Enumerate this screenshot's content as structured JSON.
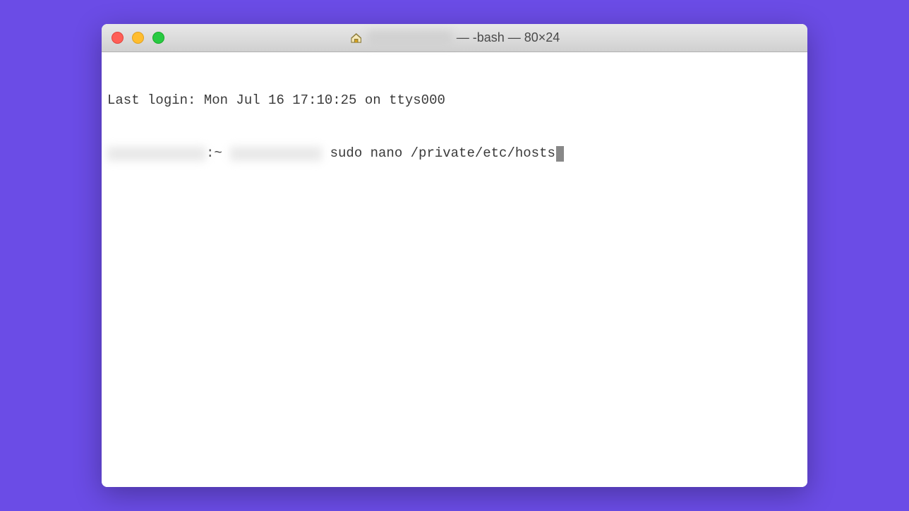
{
  "titlebar": {
    "title_suffix": " — -bash — 80×24"
  },
  "terminal": {
    "line1": "Last login: Mon Jul 16 17:10:25 on ttys000",
    "prompt_suffix": ":~ ",
    "command": " sudo nano /private/etc/hosts"
  }
}
